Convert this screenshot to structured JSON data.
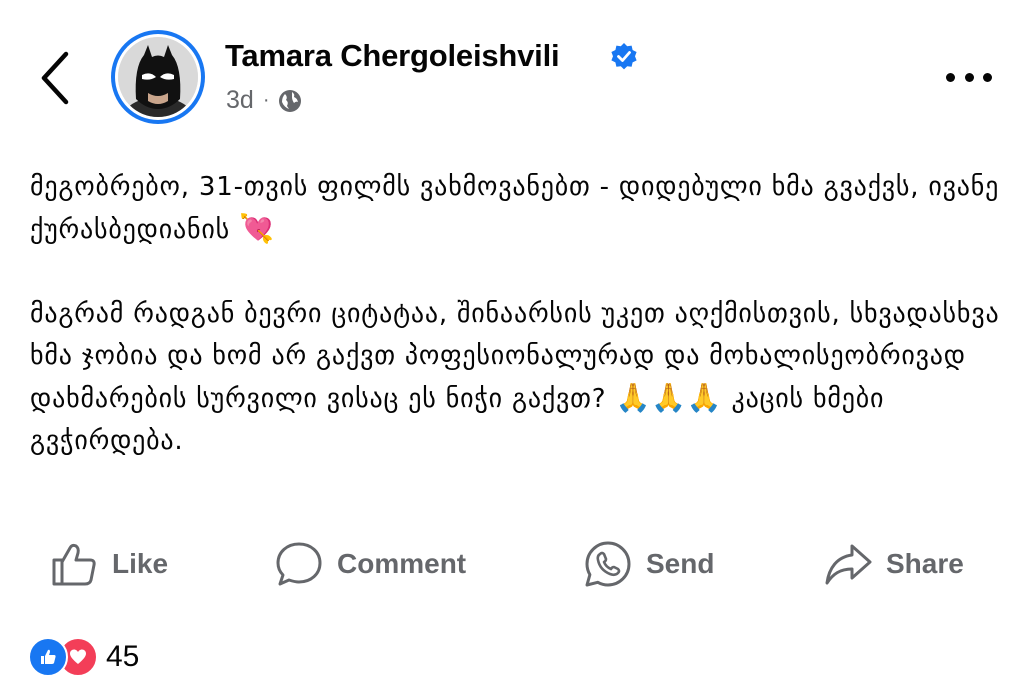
{
  "header": {
    "author_name": "Tamara Chergoleishvili",
    "timestamp": "3d",
    "separator": "·",
    "privacy_icon": "globe-icon",
    "verified_icon": "verified-badge-icon",
    "back_icon": "chevron-left-icon",
    "more_icon": "more-horizontal-icon"
  },
  "post": {
    "paragraph1": "მეგობრებო, 31-თვის ფილმს ვახმოვანებთ - დიდებული ხმა გვაქვს, ივანე ქურასბედიანის",
    "paragraph1_emoji": "💘",
    "paragraph2": "მაგრამ რადგან ბევრი ციტატაა, შინაარსის უკეთ აღქმისთვის, სხვადასხვა ხმა ჯობია და ხომ არ გაქვთ პოფესიონალურად და მოხალისეობრივად დახმარების სურვილი ვისაც ეს ნიჭი გაქვთ?",
    "paragraph2_emoji": "🙏🙏🙏",
    "paragraph2_end": "კაცის ხმები გვჭირდება."
  },
  "actions": {
    "like_label": "Like",
    "comment_label": "Comment",
    "send_label": "Send",
    "share_label": "Share"
  },
  "reactions": {
    "types": [
      "like",
      "love"
    ],
    "count": "45"
  },
  "colors": {
    "brand_blue": "#1877f2",
    "secondary_text": "#65676b",
    "love_red": "#f33e58"
  }
}
